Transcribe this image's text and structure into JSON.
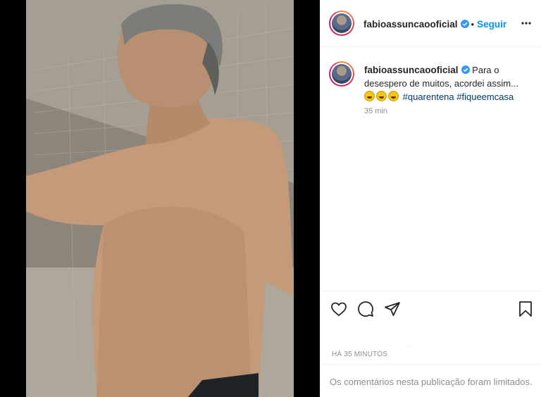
{
  "post": {
    "username": "fabioassuncaooficial",
    "follow_label": "Seguir",
    "caption_text": "Para o desespero de muitos, acordei assim...",
    "emojis": [
      "grinning-face",
      "grinning-face",
      "grinning-face"
    ],
    "hashtags": [
      "#quarentena",
      "#fiqueemcasa"
    ],
    "relative_time": "35 min",
    "date_label": "HÁ 35 MINUTOS",
    "comments_limited_text": "Os comentários nesta publicação foram limitados."
  },
  "icons": {
    "verified": "verified-badge-icon",
    "more": "more-options-icon",
    "like": "heart-icon",
    "comment": "comment-icon",
    "share": "share-icon",
    "save": "bookmark-icon"
  },
  "colors": {
    "accent": "#0095f6",
    "hashtag": "#00376b",
    "muted": "#8e8e8e",
    "text": "#262626"
  }
}
